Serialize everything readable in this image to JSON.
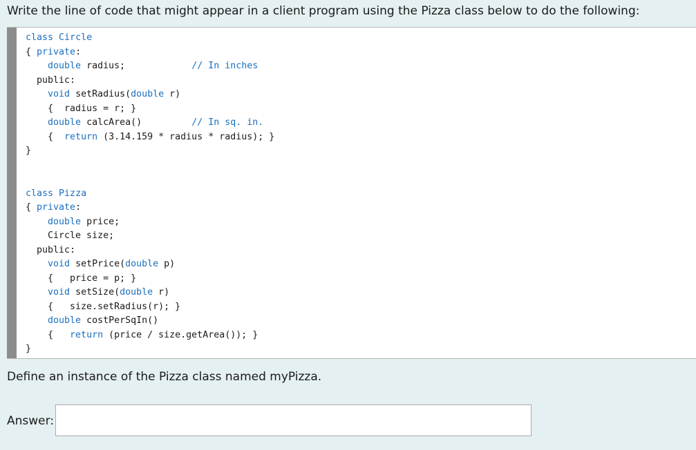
{
  "question": "Write the line of code that might appear in a client program using the Pizza class below to do the following:",
  "code_lines": [
    [
      {
        "t": "class ",
        "c": "kw"
      },
      {
        "t": "Circle",
        "c": "kw"
      }
    ],
    [
      {
        "t": "{ ",
        "c": ""
      },
      {
        "t": "private",
        "c": "kw"
      },
      {
        "t": ":",
        "c": ""
      }
    ],
    [
      {
        "t": "    ",
        "c": ""
      },
      {
        "t": "double",
        "c": "kw"
      },
      {
        "t": " radius;            ",
        "c": ""
      },
      {
        "t": "// In inches",
        "c": "cm"
      }
    ],
    [
      {
        "t": "  public:",
        "c": ""
      }
    ],
    [
      {
        "t": "    ",
        "c": ""
      },
      {
        "t": "void",
        "c": "kw"
      },
      {
        "t": " setRadius(",
        "c": ""
      },
      {
        "t": "double",
        "c": "kw"
      },
      {
        "t": " r)",
        "c": ""
      }
    ],
    [
      {
        "t": "    {  radius = r; }",
        "c": ""
      }
    ],
    [
      {
        "t": "    ",
        "c": ""
      },
      {
        "t": "double",
        "c": "kw"
      },
      {
        "t": " calcArea()         ",
        "c": ""
      },
      {
        "t": "// In sq. in.",
        "c": "cm"
      }
    ],
    [
      {
        "t": "    {  ",
        "c": ""
      },
      {
        "t": "return",
        "c": "kw"
      },
      {
        "t": " (3.14.159 * radius * radius); }",
        "c": ""
      }
    ],
    [
      {
        "t": "}",
        "c": ""
      }
    ],
    [
      {
        "t": "",
        "c": ""
      }
    ],
    [
      {
        "t": "",
        "c": ""
      }
    ],
    [
      {
        "t": "class ",
        "c": "kw"
      },
      {
        "t": "Pizza",
        "c": "kw"
      }
    ],
    [
      {
        "t": "{ ",
        "c": ""
      },
      {
        "t": "private",
        "c": "kw"
      },
      {
        "t": ":",
        "c": ""
      }
    ],
    [
      {
        "t": "    ",
        "c": ""
      },
      {
        "t": "double",
        "c": "kw"
      },
      {
        "t": " price;",
        "c": ""
      }
    ],
    [
      {
        "t": "    Circle size;",
        "c": ""
      }
    ],
    [
      {
        "t": "  public:",
        "c": ""
      }
    ],
    [
      {
        "t": "    ",
        "c": ""
      },
      {
        "t": "void",
        "c": "kw"
      },
      {
        "t": " setPrice(",
        "c": ""
      },
      {
        "t": "double",
        "c": "kw"
      },
      {
        "t": " p)",
        "c": ""
      }
    ],
    [
      {
        "t": "    {   price = p; }",
        "c": ""
      }
    ],
    [
      {
        "t": "    ",
        "c": ""
      },
      {
        "t": "void",
        "c": "kw"
      },
      {
        "t": " setSize(",
        "c": ""
      },
      {
        "t": "double",
        "c": "kw"
      },
      {
        "t": " r)",
        "c": ""
      }
    ],
    [
      {
        "t": "    {   size.setRadius(r); }",
        "c": ""
      }
    ],
    [
      {
        "t": "    ",
        "c": ""
      },
      {
        "t": "double",
        "c": "kw"
      },
      {
        "t": " costPerSqIn()",
        "c": ""
      }
    ],
    [
      {
        "t": "    {   ",
        "c": ""
      },
      {
        "t": "return",
        "c": "kw"
      },
      {
        "t": " (price / size.getArea()); }",
        "c": ""
      }
    ],
    [
      {
        "t": "}",
        "c": ""
      }
    ]
  ],
  "sub_question": "Define an instance of the Pizza class named myPizza.",
  "answer": {
    "label": "Answer:",
    "value": ""
  },
  "colors": {
    "page_background": "#e5f0f2",
    "keyword": "#1b6fbf",
    "code_bar": "#8c8c8c"
  }
}
